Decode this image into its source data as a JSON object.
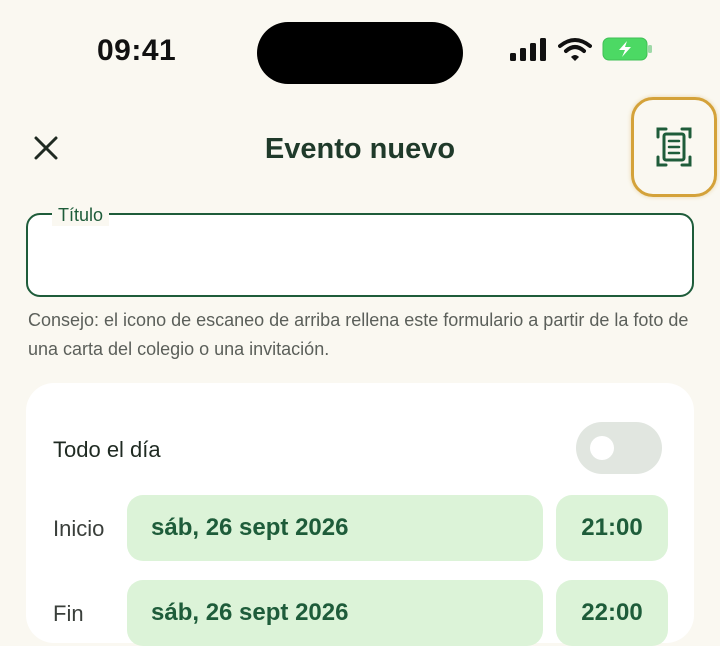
{
  "status_bar": {
    "time": "09:41"
  },
  "header": {
    "title": "Evento nuevo"
  },
  "form": {
    "title_label": "Título",
    "title_value": "",
    "hint": "Consejo: el icono de escaneo de arriba rellena este formulario a partir de la foto de una carta del colegio o una invitación.",
    "all_day_label": "Todo el día",
    "all_day_on": false,
    "start": {
      "label": "Inicio",
      "date": "sáb, 26 sept 2026",
      "time": "21:00"
    },
    "end": {
      "label": "Fin",
      "date": "sáb, 26 sept 2026",
      "time": "22:00"
    }
  },
  "colors": {
    "accent": "#1e5c3a",
    "pill_bg": "#dcf3d8",
    "highlight": "#d4a23a",
    "background": "#faf8f1"
  },
  "icons": [
    "close-icon",
    "scan-document-icon",
    "signal-icon",
    "wifi-icon",
    "battery-charging-icon"
  ]
}
